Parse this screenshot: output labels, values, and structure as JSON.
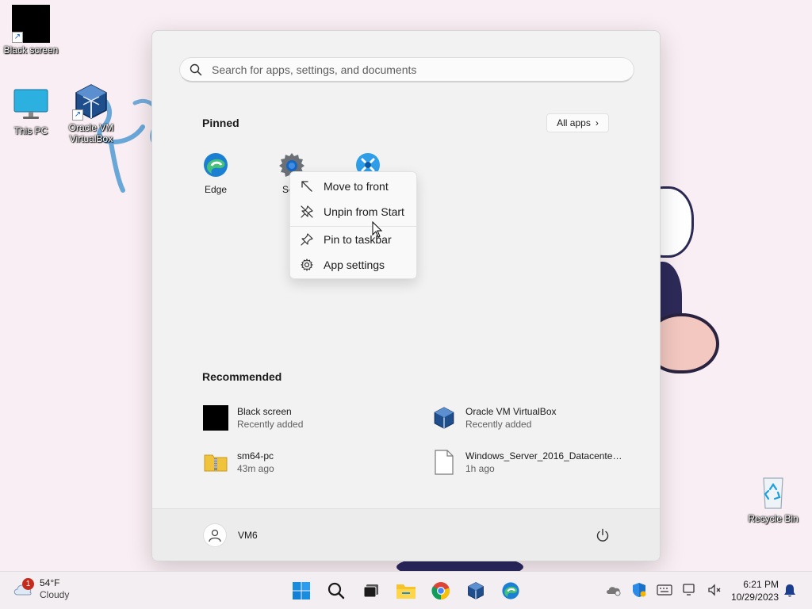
{
  "desktop": {
    "icons": [
      {
        "label": "Black screen",
        "icon": "black-screen-icon"
      },
      {
        "label": "This PC",
        "icon": "monitor-icon"
      },
      {
        "label": "Oracle VM VirtualBox",
        "icon": "virtualbox-icon"
      },
      {
        "label": "Recycle Bin",
        "icon": "recycle-bin-icon"
      }
    ]
  },
  "start_menu": {
    "search": {
      "placeholder": "Search for apps, settings, and documents"
    },
    "pinned": {
      "title": "Pinned",
      "all_apps_label": "All apps",
      "apps": [
        {
          "label": "Edge",
          "icon": "edge-icon"
        },
        {
          "label": "Setti",
          "icon": "settings-icon"
        },
        {
          "label": "",
          "icon": "snipping-app-icon"
        }
      ]
    },
    "recommended": {
      "title": "Recommended",
      "items": [
        {
          "name": "Black screen",
          "sub": "Recently added",
          "icon": "black-screen-icon"
        },
        {
          "name": "Oracle VM VirtualBox",
          "sub": "Recently added",
          "icon": "virtualbox-icon"
        },
        {
          "name": "sm64-pc",
          "sub": "43m ago",
          "icon": "zip-folder-icon"
        },
        {
          "name": "Windows_Server_2016_Datacenter_...",
          "sub": "1h ago",
          "icon": "file-icon"
        }
      ]
    },
    "user": {
      "name": "VM6"
    }
  },
  "context_menu": {
    "items": [
      {
        "label": "Move to front",
        "icon": "move-to-front-icon"
      },
      {
        "label": "Unpin from Start",
        "icon": "unpin-icon"
      },
      {
        "label": "Pin to taskbar",
        "icon": "pin-icon"
      },
      {
        "label": "App settings",
        "icon": "gear-icon"
      }
    ]
  },
  "taskbar": {
    "weather": {
      "temp": "54°F",
      "condition": "Cloudy",
      "badge": "1"
    },
    "apps": [
      "start-icon",
      "search-icon",
      "task-view-icon",
      "file-explorer-icon",
      "chrome-icon",
      "virtualbox-icon",
      "edge-icon"
    ],
    "clock": {
      "time": "6:21 PM",
      "date": "10/29/2023"
    }
  },
  "colors": {
    "accent": "#0067c0",
    "badge": "#c42b1c"
  }
}
